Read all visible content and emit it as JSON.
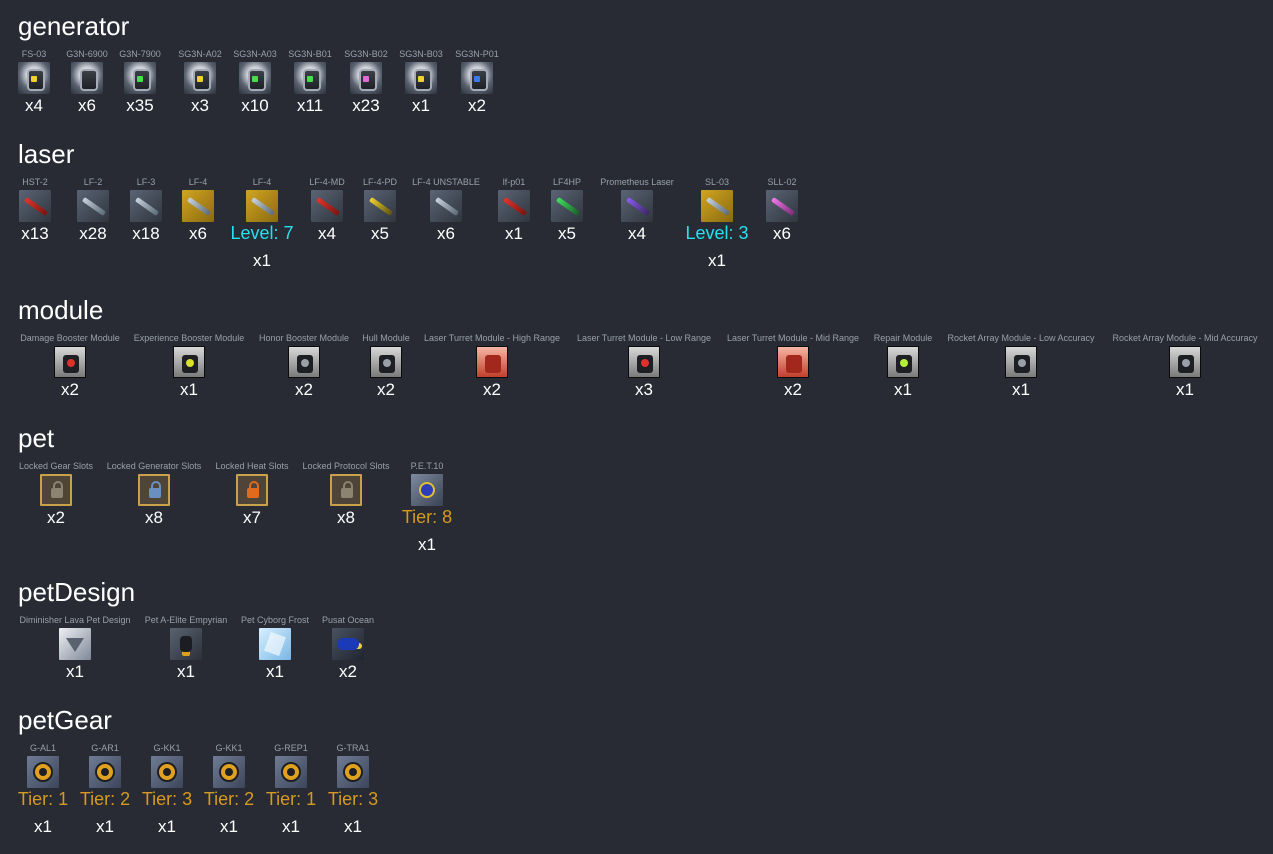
{
  "sections": [
    {
      "title": "generator",
      "items": [
        {
          "label": "FS-03",
          "count": "x4",
          "icon": "ic-gen ic-gen-y",
          "icon_name": "generator-icon"
        },
        {
          "label": "G3N-6900",
          "count": "x6",
          "icon": "ic-gen",
          "icon_name": "generator-icon"
        },
        {
          "label": "G3N-7900",
          "count": "x35",
          "icon": "ic-gen ic-gen-g",
          "icon_name": "generator-icon"
        },
        {
          "label": "SG3N-A02",
          "count": "x3",
          "icon": "ic-gen ic-gen-y",
          "icon_name": "shield-generator-icon"
        },
        {
          "label": "SG3N-A03",
          "count": "x10",
          "icon": "ic-gen ic-gen-g",
          "icon_name": "shield-generator-icon"
        },
        {
          "label": "SG3N-B01",
          "count": "x11",
          "icon": "ic-gen ic-gen-g",
          "icon_name": "shield-generator-icon"
        },
        {
          "label": "SG3N-B02",
          "count": "x23",
          "icon": "ic-gen ic-gen-m",
          "icon_name": "shield-generator-icon"
        },
        {
          "label": "SG3N-B03",
          "count": "x1",
          "icon": "ic-gen ic-gen-y",
          "icon_name": "shield-generator-icon"
        },
        {
          "label": "SG3N-P01",
          "count": "x2",
          "icon": "ic-gen ic-gen-b",
          "icon_name": "shield-generator-icon"
        }
      ]
    },
    {
      "title": "laser",
      "items": [
        {
          "label": "HST-2",
          "count": "x13",
          "icon": "ic-laser ic-laser-red",
          "icon_name": "laser-icon"
        },
        {
          "label": "LF-2",
          "count": "x28",
          "icon": "ic-laser",
          "icon_name": "laser-icon"
        },
        {
          "label": "LF-3",
          "count": "x18",
          "icon": "ic-laser",
          "icon_name": "laser-icon"
        },
        {
          "label": "LF-4",
          "count": "x6",
          "icon": "ic-laser ic-laser-gold",
          "icon_name": "laser-icon"
        },
        {
          "label": "LF-4",
          "extra": "Level: 7",
          "extra_type": "level",
          "count": "x1",
          "icon": "ic-laser ic-laser-gold",
          "icon_name": "laser-icon"
        },
        {
          "label": "LF-4-MD",
          "count": "x4",
          "icon": "ic-laser ic-laser-red",
          "icon_name": "laser-icon"
        },
        {
          "label": "LF-4-PD",
          "count": "x5",
          "icon": "ic-laser ic-laser-yellow",
          "icon_name": "laser-icon"
        },
        {
          "label": "LF-4 UNSTABLE",
          "count": "x6",
          "icon": "ic-laser",
          "icon_name": "laser-icon"
        },
        {
          "label": "lf-p01",
          "count": "x1",
          "icon": "ic-laser ic-laser-red",
          "icon_name": "laser-icon"
        },
        {
          "label": "LF4HP",
          "count": "x5",
          "icon": "ic-laser ic-laser-green",
          "icon_name": "laser-icon"
        },
        {
          "label": "Prometheus Laser",
          "count": "x4",
          "icon": "ic-laser ic-laser-purple",
          "icon_name": "laser-icon"
        },
        {
          "label": "SL-03",
          "extra": "Level: 3",
          "extra_type": "level",
          "count": "x1",
          "icon": "ic-laser ic-laser-gold",
          "icon_name": "laser-icon"
        },
        {
          "label": "SLL-02",
          "count": "x6",
          "icon": "ic-laser ic-laser-pink",
          "icon_name": "laser-icon"
        }
      ]
    },
    {
      "title": "module",
      "items": [
        {
          "label": "Damage Booster Module",
          "count": "x2",
          "icon": "ic-mod ic-mod-red",
          "icon_name": "module-icon"
        },
        {
          "label": "Experience Booster Module",
          "count": "x1",
          "icon": "ic-mod ic-mod-yellow",
          "icon_name": "module-icon"
        },
        {
          "label": "Honor Booster Module",
          "count": "x2",
          "icon": "ic-mod ic-mod-grey",
          "icon_name": "module-icon"
        },
        {
          "label": "Hull Module",
          "count": "x2",
          "icon": "ic-mod ic-mod-grey",
          "icon_name": "module-icon"
        },
        {
          "label": "Laser Turret Module - High Range",
          "count": "x2",
          "icon": "ic-mod ic-mod-orange",
          "icon_name": "turret-module-icon"
        },
        {
          "label": "Laser Turret Module - Low Range",
          "count": "x3",
          "icon": "ic-mod ic-mod-red",
          "icon_name": "turret-module-icon"
        },
        {
          "label": "Laser Turret Module - Mid Range",
          "count": "x2",
          "icon": "ic-mod ic-mod-orange",
          "icon_name": "turret-module-icon"
        },
        {
          "label": "Repair Module",
          "count": "x1",
          "icon": "ic-mod ic-mod-green",
          "icon_name": "module-icon"
        },
        {
          "label": "Rocket Array Module - Low Accuracy",
          "count": "x1",
          "icon": "ic-mod ic-mod-grey",
          "icon_name": "rocket-module-icon"
        },
        {
          "label": "Rocket Array Module - Mid Accuracy",
          "count": "x1",
          "icon": "ic-mod ic-mod-grey",
          "icon_name": "rocket-module-icon"
        }
      ]
    },
    {
      "title": "pet",
      "items": [
        {
          "label": "Locked Gear Slots",
          "count": "x2",
          "icon": "ic-pet-lock",
          "icon_name": "lock-icon"
        },
        {
          "label": "Locked Generator Slots",
          "count": "x8",
          "icon": "ic-pet-lock ic-pet-lock-blue",
          "icon_name": "lock-icon"
        },
        {
          "label": "Locked Heat Slots",
          "count": "x7",
          "icon": "ic-pet-lock ic-pet-lock-orange",
          "icon_name": "lock-icon"
        },
        {
          "label": "Locked Protocol Slots",
          "count": "x8",
          "icon": "ic-pet-lock",
          "icon_name": "lock-icon"
        },
        {
          "label": "P.E.T.10",
          "extra": "Tier: 8",
          "extra_type": "tier",
          "count": "x1",
          "icon": "ic-pet",
          "icon_name": "pet-icon"
        }
      ]
    },
    {
      "title": "petDesign",
      "items": [
        {
          "label": "Diminisher Lava Pet Design",
          "count": "x1",
          "icon": "ic-pd1",
          "icon_name": "pet-design-icon"
        },
        {
          "label": "Pet A-Elite Empyrian",
          "count": "x1",
          "icon": "ic-pd2",
          "icon_name": "pet-design-icon"
        },
        {
          "label": "Pet Cyborg Frost",
          "count": "x1",
          "icon": "ic-pd3",
          "icon_name": "pet-design-icon"
        },
        {
          "label": "Pusat Ocean",
          "count": "x2",
          "icon": "ic-pd4",
          "icon_name": "pet-design-icon"
        }
      ]
    },
    {
      "title": "petGear",
      "items": [
        {
          "label": "G-AL1",
          "extra": "Tier: 1",
          "extra_type": "tier",
          "count": "x1",
          "icon": "ic-gear",
          "icon_name": "gear-icon"
        },
        {
          "label": "G-AR1",
          "extra": "Tier: 2",
          "extra_type": "tier",
          "count": "x1",
          "icon": "ic-gear",
          "icon_name": "gear-icon"
        },
        {
          "label": "G-KK1",
          "extra": "Tier: 3",
          "extra_type": "tier",
          "count": "x1",
          "icon": "ic-gear",
          "icon_name": "gear-icon"
        },
        {
          "label": "G-KK1",
          "extra": "Tier: 2",
          "extra_type": "tier",
          "count": "x1",
          "icon": "ic-gear",
          "icon_name": "gear-icon"
        },
        {
          "label": "G-REP1",
          "extra": "Tier: 1",
          "extra_type": "tier",
          "count": "x1",
          "icon": "ic-gear",
          "icon_name": "gear-icon"
        },
        {
          "label": "G-TRA1",
          "extra": "Tier: 3",
          "extra_type": "tier",
          "count": "x1",
          "icon": "ic-gear",
          "icon_name": "gear-icon"
        }
      ]
    }
  ]
}
